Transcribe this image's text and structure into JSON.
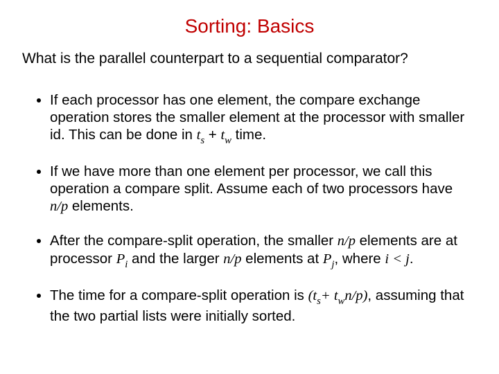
{
  "title": "Sorting: Basics",
  "question": "What is the parallel counterpart to a sequential comparator?",
  "b1": {
    "a": "If each processor has one element, the compare exchange operation stores the smaller element at the processor with smaller id. This can be done in ",
    "ts": "t",
    "ts_sub": "s",
    "plus": " + ",
    "tw": "t",
    "tw_sub": "w",
    "b": " time."
  },
  "b2": {
    "a": "If we have more than one element per processor, we call this operation a compare split. Assume each of two processors have ",
    "np": "n/p",
    "b": " elements."
  },
  "b3": {
    "a": "After the compare-split operation, the smaller ",
    "np1": "n/p",
    "b": " elements are at processor ",
    "P1": "P",
    "i": "i",
    "c": " and the larger ",
    "np2": "n/p",
    "d": " elements at ",
    "P2": "P",
    "j": "j",
    "e": ", where ",
    "rel": "i < j",
    "f": "."
  },
  "b4": {
    "a": "The time for a compare-split operation is ",
    "open": "(",
    "ts": "t",
    "ts_sub": "s",
    "plus": "+ ",
    "tw": "t",
    "tw_sub": "w",
    "np": "n/p",
    "close": ")",
    "b": ", assuming that the two partial lists were initially sorted."
  }
}
